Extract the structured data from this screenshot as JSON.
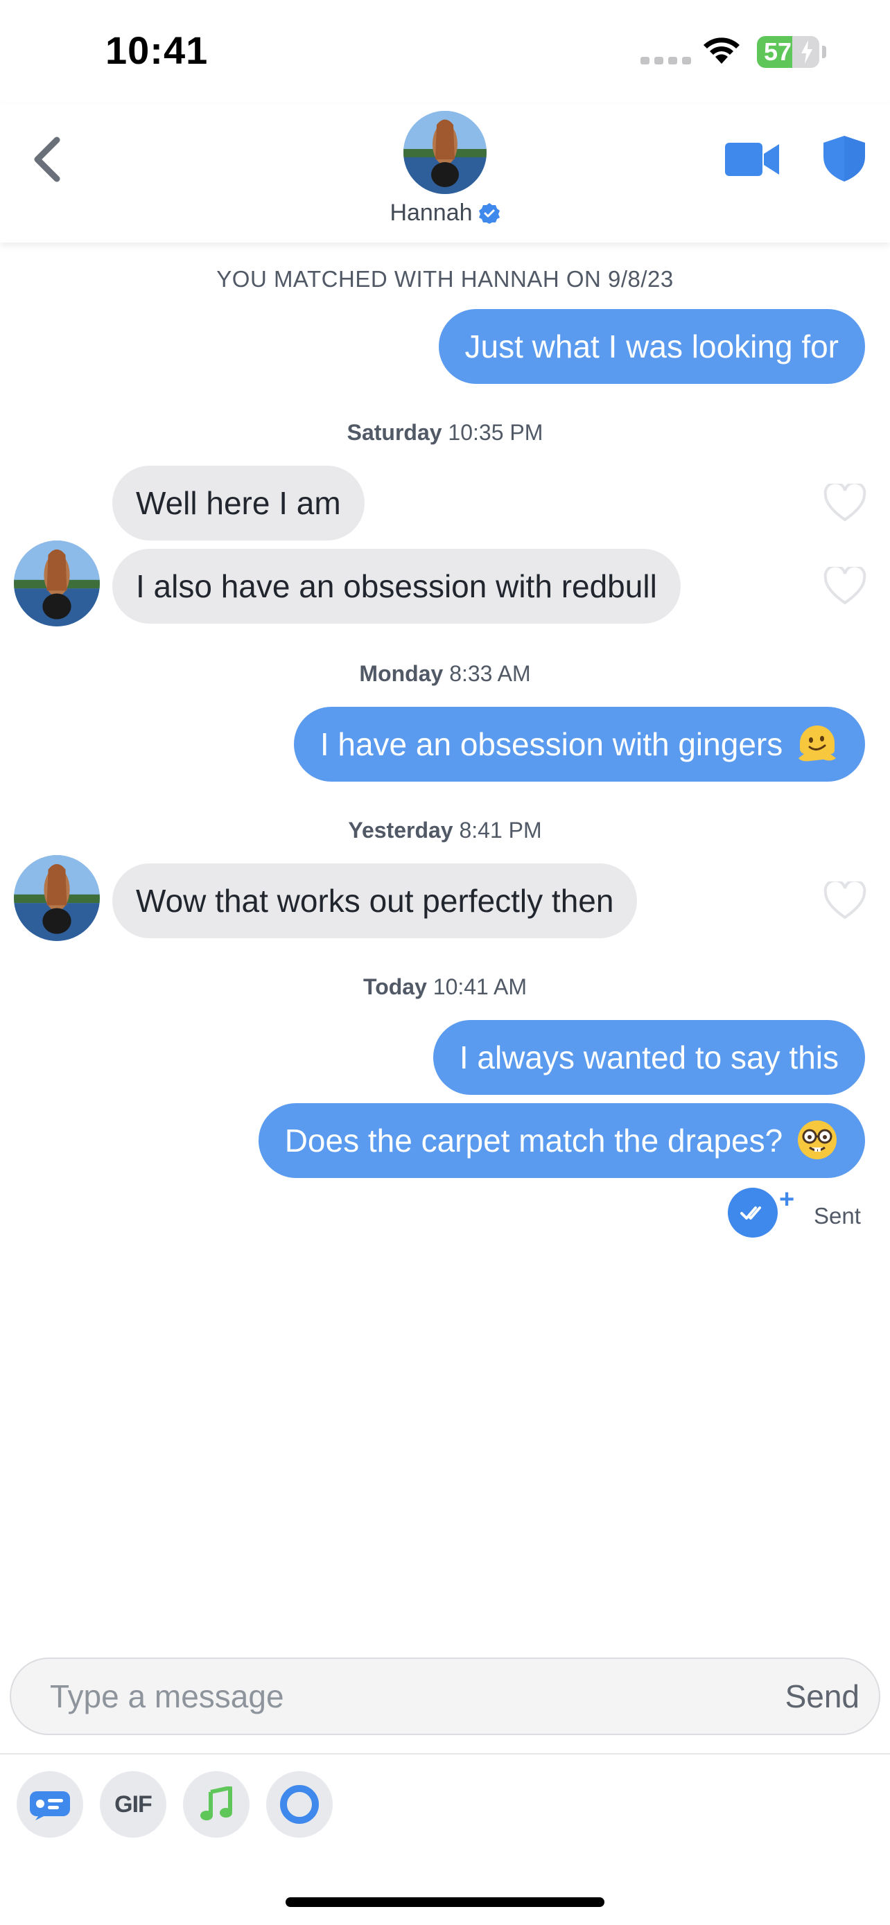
{
  "status_bar": {
    "time": "10:41",
    "battery_percent": "57",
    "battery_level": 0.57,
    "battery_color": "#5fc65a"
  },
  "header": {
    "back_icon": "chevron-left-icon",
    "name": "Hannah",
    "verified_icon": "verified-badge-icon",
    "video_icon": "video-camera-icon",
    "safety_icon": "shield-icon",
    "accent_color": "#3f88ec"
  },
  "chat": {
    "match_notice": "YOU MATCHED WITH HANNAH ON 9/8/23",
    "groups": [
      {
        "messages": [
          {
            "direction": "out",
            "text": "Just what I was looking for"
          }
        ]
      },
      {
        "day": "Saturday",
        "time": "10:35 PM",
        "messages": [
          {
            "direction": "in",
            "text": "Well here I am",
            "liked": false
          },
          {
            "direction": "in",
            "text": "I also have an obsession with redbull",
            "liked": false
          }
        ]
      },
      {
        "day": "Monday",
        "time": "8:33 AM",
        "messages": [
          {
            "direction": "out",
            "text": "I have an obsession with gingers",
            "emoji": "melting-face-emoji"
          }
        ]
      },
      {
        "day": "Yesterday",
        "time": "8:41 PM",
        "messages": [
          {
            "direction": "in",
            "text": "Wow that works out perfectly then",
            "liked": false
          }
        ]
      },
      {
        "day": "Today",
        "time": "10:41 AM",
        "messages": [
          {
            "direction": "out",
            "text": "I always wanted to say this"
          },
          {
            "direction": "out",
            "text": "Does the carpet match the drapes?",
            "emoji": "nerd-face-emoji"
          }
        ]
      }
    ],
    "receipt": {
      "icon": "double-check-icon",
      "plus": "+",
      "label": "Sent"
    },
    "outgoing_bubble_color": "#5a9bf0",
    "incoming_bubble_color": "#e9e9eb"
  },
  "composer": {
    "placeholder": "Type a message",
    "send_label": "Send"
  },
  "toolbar": {
    "items": [
      {
        "icon": "message-card-icon"
      },
      {
        "label": "GIF"
      },
      {
        "icon": "music-note-icon"
      },
      {
        "icon": "ring-icon"
      }
    ]
  }
}
